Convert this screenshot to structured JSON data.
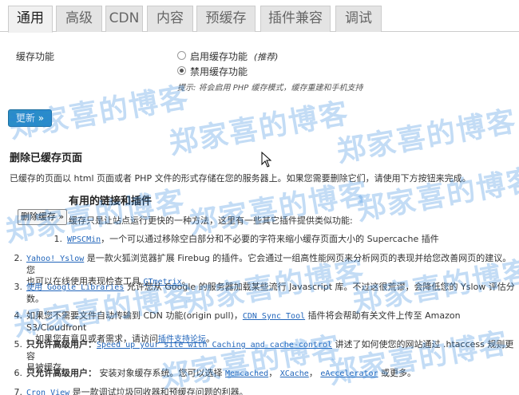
{
  "tabs": [
    {
      "label": "通用",
      "active": true
    },
    {
      "label": "高级"
    },
    {
      "label": "CDN"
    },
    {
      "label": "内容"
    },
    {
      "label": "预缓存"
    },
    {
      "label": "插件兼容"
    },
    {
      "label": "调试"
    }
  ],
  "cache_section": {
    "label": "缓存功能",
    "option_on": "启用缓存功能",
    "option_on_note": "(推荐)",
    "option_off": "禁用缓存功能",
    "selected": "禁用缓存功能",
    "hint": "提示: 将会启用 PHP 缓存模式，缓存重建和手机支持"
  },
  "update_button": "更新 »",
  "delete_section": {
    "title": "删除已缓存页面",
    "desc": "已缓存的页面以 html 页面或者 PHP 文件的形式存储在您的服务器上。如果您需要删除它们，请使用下方按钮来完成。",
    "button": "删除缓存 »"
  },
  "links_section": {
    "title": "有用的链接和插件",
    "intro": "缓存只是让站点运行更快的一种方法，这里有一些其它插件提供类似功能:"
  },
  "items": [
    {
      "num": "1.",
      "link": "WPSCMin",
      "text": "，一个可以通过移除空白部分和不必要的字符来缩小缓存页面大小的 Supercache 插件"
    },
    {
      "num": "2.",
      "link": "Yahoo! Yslow",
      "text": " 是一款火狐浏览器扩展 Firebug 的插件。它会通过一组高性能网页来分析网页的表现并给您改善网页的建议。您",
      "line2": "也可以在线使用表现检查工具 ",
      "link2": "GTmetrix",
      "tail2": "。"
    },
    {
      "num": "3.",
      "link": "使用 Google Libraries",
      "text": " 允许您从 Google 的服务器加载某些流行 Javascript 库。不过这很荒谬，会降低您的 Yslow 评估分",
      "line2": "数。"
    },
    {
      "num": "4.",
      "text_pre": "如果您不需要文件自动传输到 CDN 功能(origin pull)，",
      "link": "CDN Sync Tool",
      "text": " 插件将会帮助有关文件上传至 Amazon S3/Cloudfront",
      "line2": "。如果您有意见或者需求，请访问",
      "link2": "插件支持论坛",
      "tail2": "。"
    },
    {
      "num": "5.",
      "bold": "只允许高级用户：",
      "link": "Speed up your site with Caching and cache-control",
      "text": " 讲述了如何使您的网站通过 .htaccess 规则更容",
      "line2": "易被缓存。"
    },
    {
      "num": "6.",
      "bold": "只允许高级用户：",
      "text_pre": " 安装对象缓存系统。您可以选择 ",
      "link": "Memcached",
      "sep1": "， ",
      "link_b": "XCache",
      "sep2": "， ",
      "link_c": "eAccelerator",
      "text": " 或更多。"
    },
    {
      "num": "7.",
      "link": "Cron View",
      "text": " 是一款调试垃圾回收器和预缓存问题的利器。"
    }
  ],
  "watermark": "郑家喜的博客"
}
